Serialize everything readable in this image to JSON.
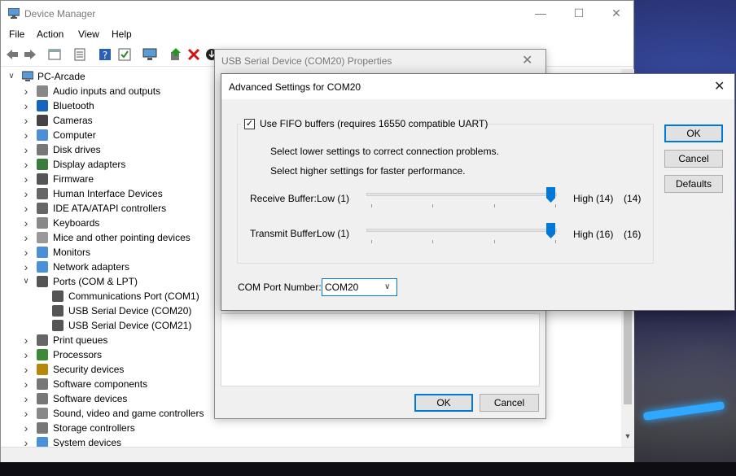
{
  "device_manager": {
    "title": "Device Manager",
    "menu": [
      "File",
      "Action",
      "View",
      "Help"
    ],
    "tree": [
      {
        "label": "PC-Arcade",
        "icon": "computer-icon",
        "expanded": true
      },
      {
        "label": "Audio inputs and outputs",
        "icon": "speaker-icon"
      },
      {
        "label": "Bluetooth",
        "icon": "bluetooth-icon"
      },
      {
        "label": "Cameras",
        "icon": "camera-icon"
      },
      {
        "label": "Computer",
        "icon": "monitor-icon"
      },
      {
        "label": "Disk drives",
        "icon": "disk-icon"
      },
      {
        "label": "Display adapters",
        "icon": "display-adapter-icon"
      },
      {
        "label": "Firmware",
        "icon": "chip-icon"
      },
      {
        "label": "Human Interface Devices",
        "icon": "hid-icon"
      },
      {
        "label": "IDE ATA/ATAPI controllers",
        "icon": "ide-icon"
      },
      {
        "label": "Keyboards",
        "icon": "keyboard-icon"
      },
      {
        "label": "Mice and other pointing devices",
        "icon": "mouse-icon"
      },
      {
        "label": "Monitors",
        "icon": "monitor-icon"
      },
      {
        "label": "Network adapters",
        "icon": "network-icon"
      },
      {
        "label": "Ports (COM & LPT)",
        "icon": "port-icon",
        "expanded": true
      },
      {
        "label": "Communications Port (COM1)",
        "icon": "port-icon",
        "child": true
      },
      {
        "label": "USB Serial Device (COM20)",
        "icon": "port-icon",
        "child": true
      },
      {
        "label": "USB Serial Device (COM21)",
        "icon": "port-icon",
        "child": true
      },
      {
        "label": "Print queues",
        "icon": "printer-icon"
      },
      {
        "label": "Processors",
        "icon": "cpu-icon"
      },
      {
        "label": "Security devices",
        "icon": "security-icon"
      },
      {
        "label": "Software components",
        "icon": "software-icon"
      },
      {
        "label": "Software devices",
        "icon": "software-icon"
      },
      {
        "label": "Sound, video and game controllers",
        "icon": "sound-icon"
      },
      {
        "label": "Storage controllers",
        "icon": "storage-icon"
      },
      {
        "label": "System devices",
        "icon": "system-icon"
      }
    ]
  },
  "properties_dialog": {
    "title": "USB Serial Device (COM20) Properties",
    "ok_label": "OK",
    "cancel_label": "Cancel"
  },
  "advanced_dialog": {
    "title": "Advanced Settings for COM20",
    "fifo": {
      "label": "Use FIFO buffers (requires 16550 compatible UART)",
      "checked": true
    },
    "hint_lower": "Select lower settings to correct connection problems.",
    "hint_higher": "Select higher settings for faster performance.",
    "receive": {
      "label": "Receive Buffer:",
      "low": "Low (1)",
      "high": "High (14)",
      "value": "(14)",
      "fraction": 1.0
    },
    "transmit": {
      "label": "Transmit Buffer:",
      "low": "Low (1)",
      "high": "High (16)",
      "value": "(16)",
      "fraction": 1.0
    },
    "com_port": {
      "label": "COM Port Number:",
      "value": "COM20"
    },
    "ok_label": "OK",
    "cancel_label": "Cancel",
    "defaults_label": "Defaults"
  },
  "colors": {
    "accent": "#0078d7"
  }
}
